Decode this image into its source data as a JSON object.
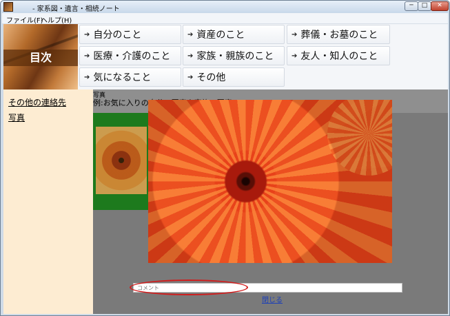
{
  "window": {
    "title": "- 家系図・遺言・相続ノート",
    "controls": {
      "minimize": "─",
      "maximize": "□",
      "close": "✕"
    }
  },
  "menu": {
    "items": [
      {
        "label": "ファイル(F)"
      },
      {
        "label": "ヘルプ(H)"
      }
    ]
  },
  "header": {
    "index_label": "目次",
    "nav_arrow": "➔",
    "nav_buttons": [
      {
        "label": "自分のこと"
      },
      {
        "label": "資産のこと"
      },
      {
        "label": "葬儀・お墓のこと"
      },
      {
        "label": "医療・介護のこと"
      },
      {
        "label": "家族・親族のこと"
      },
      {
        "label": "友人・知人のこと"
      },
      {
        "label": "気になること"
      },
      {
        "label": "その他"
      }
    ]
  },
  "sidebar": {
    "links": [
      {
        "label": "その他の連絡先"
      },
      {
        "label": "写真"
      }
    ]
  },
  "content": {
    "photo_heading": "写真",
    "photo_example": "例:お気に入りの自分の写真や家族の写真"
  },
  "viewer": {
    "comment_placeholder": "コメント",
    "close_label": "閉じる"
  },
  "colors": {
    "sidebar_bg": "#fdecd2",
    "thumb_frame": "#1d7a1d",
    "highlight_ring": "#d21c1c",
    "link": "#1c3fb8"
  }
}
